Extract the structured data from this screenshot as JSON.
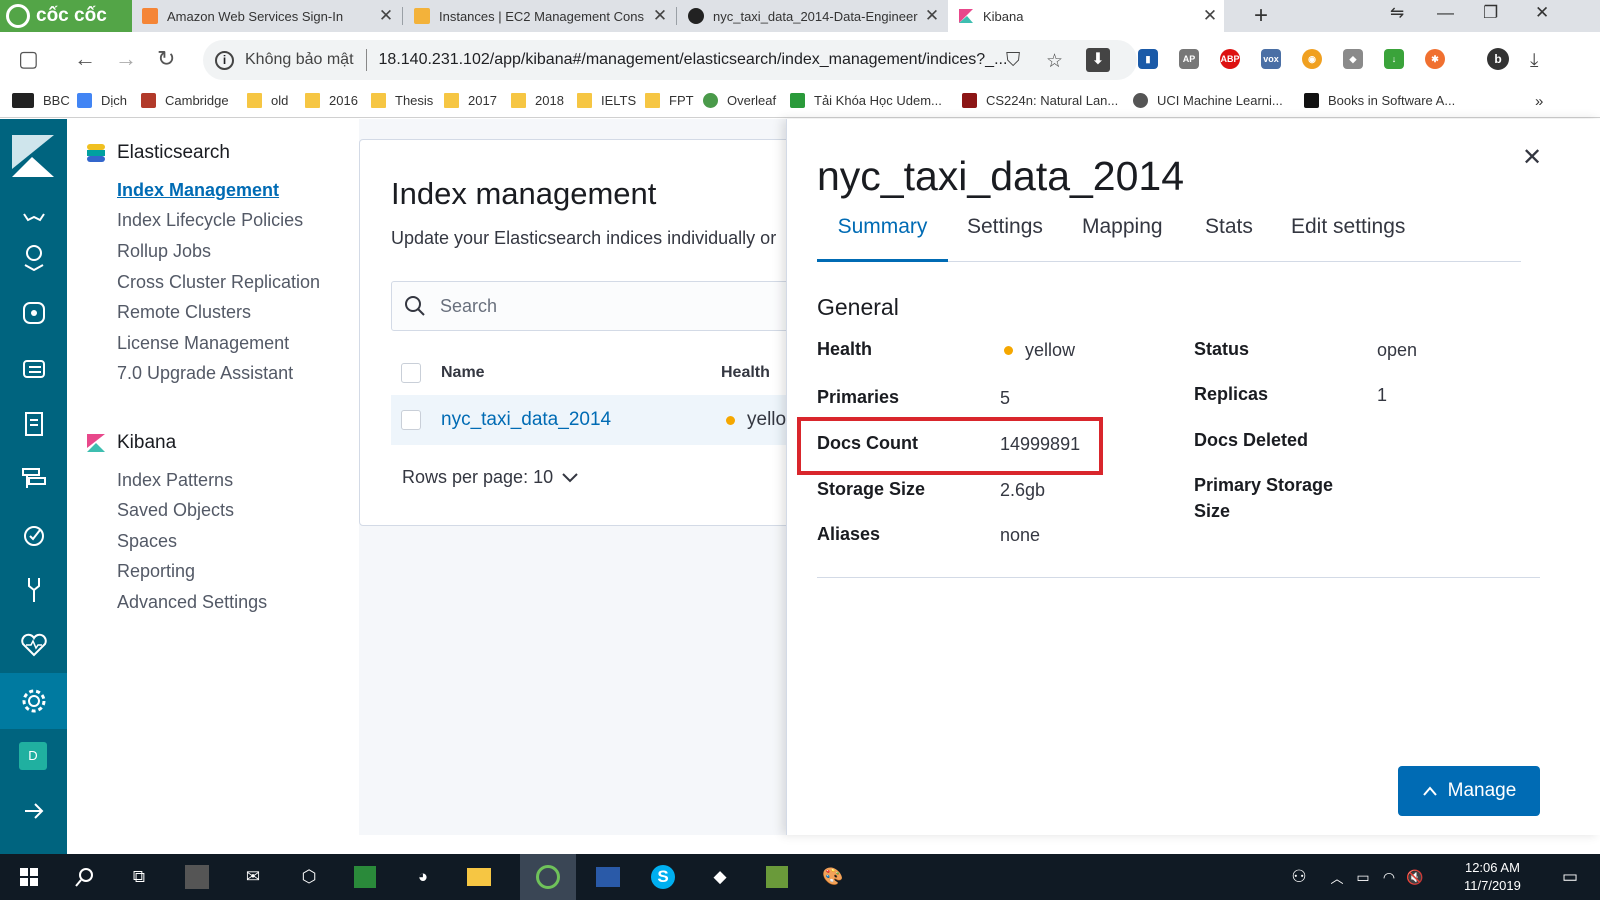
{
  "browser": {
    "brand": "cốc cốc",
    "tabs": [
      {
        "title": "Amazon Web Services Sign-In",
        "icon": "aws-icon",
        "color": "#f58536"
      },
      {
        "title": "Instances | EC2 Management Cons",
        "icon": "ec2-icon",
        "color": "#f3b23a"
      },
      {
        "title": "nyc_taxi_data_2014-Data-Engineer",
        "icon": "github-icon",
        "color": "#222222"
      },
      {
        "title": "Kibana",
        "icon": "kibana-icon",
        "color": "#e8488b"
      }
    ],
    "address": {
      "security_label": "Không bảo mật",
      "url": "18.140.231.102/app/kibana#/management/elasticsearch/index_management/indices?_..."
    },
    "bookmarks": [
      {
        "label": "BBC",
        "icon": "bbc-icon"
      },
      {
        "label": "Dịch",
        "icon": "translate-icon"
      },
      {
        "label": "Cambridge",
        "icon": "cambridge-icon"
      },
      {
        "label": "old",
        "icon": "folder-icon"
      },
      {
        "label": "2016",
        "icon": "folder-icon"
      },
      {
        "label": "Thesis",
        "icon": "folder-icon"
      },
      {
        "label": "2017",
        "icon": "folder-icon"
      },
      {
        "label": "2018",
        "icon": "folder-icon"
      },
      {
        "label": "IELTS",
        "icon": "folder-icon"
      },
      {
        "label": "FPT",
        "icon": "folder-icon"
      },
      {
        "label": "Overleaf",
        "icon": "overleaf-icon"
      },
      {
        "label": "Tải Khóa Học Udem...",
        "icon": "udemy-icon"
      },
      {
        "label": "CS224n: Natural Lan...",
        "icon": "stanford-icon"
      },
      {
        "label": "UCI Machine Learni...",
        "icon": "globe-icon"
      },
      {
        "label": "Books in Software A...",
        "icon": "medium-icon"
      }
    ],
    "bookmarks_more": "»"
  },
  "management_nav": {
    "elasticsearch": {
      "title": "Elasticsearch",
      "items": [
        "Index Management",
        "Index Lifecycle Policies",
        "Rollup Jobs",
        "Cross Cluster Replication",
        "Remote Clusters",
        "License Management",
        "7.0 Upgrade Assistant"
      ]
    },
    "kibana": {
      "title": "Kibana",
      "items": [
        "Index Patterns",
        "Saved Objects",
        "Spaces",
        "Reporting",
        "Advanced Settings"
      ]
    }
  },
  "index_panel": {
    "title": "Index management",
    "subtitle": "Update your Elasticsearch indices individually or",
    "search_placeholder": "Search",
    "columns": {
      "name": "Name",
      "health": "Health"
    },
    "rows": [
      {
        "name": "nyc_taxi_data_2014",
        "health": "yello"
      }
    ],
    "rows_per_page": "Rows per page: 10"
  },
  "flyout": {
    "title": "nyc_taxi_data_2014",
    "tabs": [
      "Summary",
      "Settings",
      "Mapping",
      "Stats",
      "Edit settings"
    ],
    "section": "General",
    "left": [
      {
        "term": "Health",
        "value": "yellow"
      },
      {
        "term": "Primaries",
        "value": "5"
      },
      {
        "term": "Docs Count",
        "value": "14999891"
      },
      {
        "term": "Storage Size",
        "value": "2.6gb"
      },
      {
        "term": "Aliases",
        "value": "none"
      }
    ],
    "right": [
      {
        "term": "Status",
        "value": "open"
      },
      {
        "term": "Replicas",
        "value": "1"
      },
      {
        "term": "Docs Deleted",
        "value": ""
      },
      {
        "term": "Primary Storage Size",
        "value": ""
      }
    ],
    "manage_label": "Manage",
    "colors": {
      "accent": "#006bb4",
      "health_yellow": "#f5a700",
      "highlight": "#d9262c"
    }
  },
  "taskbar": {
    "time": "12:06 AM",
    "date": "11/7/2019"
  },
  "user_avatar": "D"
}
